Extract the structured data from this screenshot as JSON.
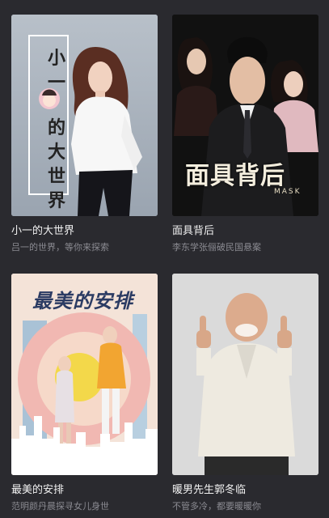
{
  "cards": [
    {
      "title": "小一的大世界",
      "subtitle": "吕一的世界，等你来探索",
      "poster": {
        "chars": [
          "小",
          "一",
          "的",
          "大",
          "世",
          "界"
        ]
      }
    },
    {
      "title": "面具背后",
      "subtitle": "李东学张俪破民国悬案",
      "poster": {
        "text": "面具背后",
        "sub": "MASK"
      }
    },
    {
      "title": "最美的安排",
      "subtitle": "范明颜丹晨探寻女儿身世",
      "poster": {
        "text": "最美的安排"
      }
    },
    {
      "title": "暖男先生郭冬临",
      "subtitle": "不管多冷，都要暖暖你"
    }
  ]
}
